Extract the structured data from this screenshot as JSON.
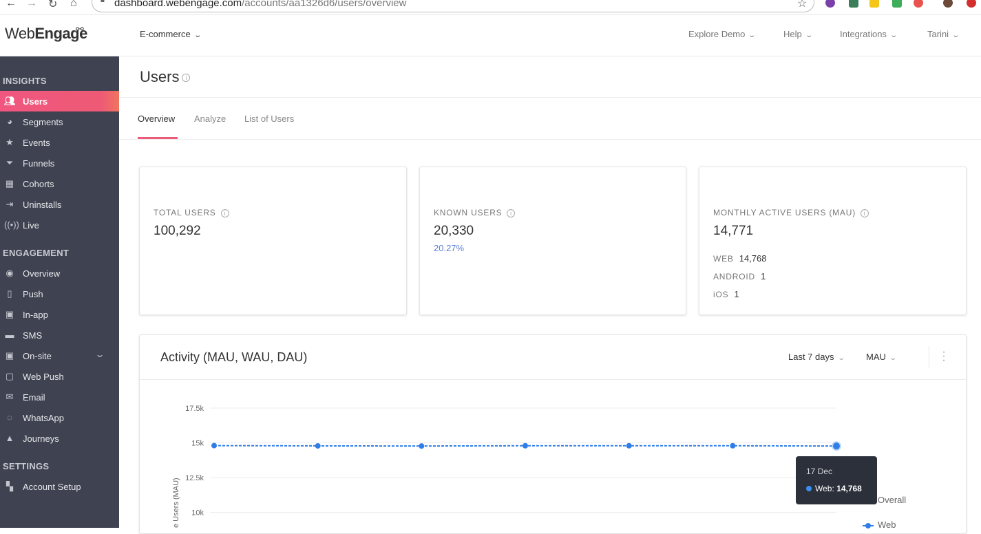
{
  "browser": {
    "url_host": "dashboard.webengage.com",
    "url_path": "/accounts/aa1326d6/users/overview"
  },
  "header": {
    "logo": {
      "part1": "Web",
      "part2": "Engage"
    },
    "project": "E-commerce",
    "menu": [
      "Explore Demo",
      "Help",
      "Integrations",
      "Tarini"
    ]
  },
  "sidebar": {
    "sections": [
      {
        "title": "INSIGHTS",
        "items": [
          "Users",
          "Segments",
          "Events",
          "Funnels",
          "Cohorts",
          "Uninstalls",
          "Live"
        ]
      },
      {
        "title": "ENGAGEMENT",
        "items": [
          "Overview",
          "Push",
          "In-app",
          "SMS",
          "On-site",
          "Web Push",
          "Email",
          "WhatsApp",
          "Journeys"
        ]
      },
      {
        "title": "SETTINGS",
        "items": [
          "Account Setup"
        ]
      }
    ],
    "active_item": "Users"
  },
  "page": {
    "title": "Users",
    "tabs": [
      "Overview",
      "Analyze",
      "List of Users"
    ],
    "active_tab": "Overview"
  },
  "cards": {
    "total": {
      "label": "TOTAL USERS",
      "value": "100,292"
    },
    "known": {
      "label": "KNOWN USERS",
      "value": "20,330",
      "percent": "20.27%"
    },
    "mau": {
      "label": "MONTHLY ACTIVE USERS (MAU)",
      "value": "14,771",
      "platforms": [
        {
          "name": "WEB",
          "value": "14,768"
        },
        {
          "name": "ANDROID",
          "value": "1"
        },
        {
          "name": "iOS",
          "value": "1"
        }
      ]
    }
  },
  "activity": {
    "title": "Activity (MAU, WAU, DAU)",
    "range": "Last 7 days",
    "metric": "MAU",
    "tooltip": {
      "date": "17 Dec",
      "series": "Web:",
      "value": "14,768"
    },
    "legend": {
      "overall": "Overall",
      "web": "Web"
    }
  },
  "chart_data": {
    "type": "line",
    "ylabel": "Users (MAU)",
    "ylabel_visible_text": "e Users (MAU)",
    "yticks": [
      "17.5k",
      "15k",
      "12.5k",
      "10k"
    ],
    "ylim": [
      10000,
      17500
    ],
    "grid": true,
    "series": [
      {
        "name": "Web",
        "values": [
          14800,
          14780,
          14770,
          14790,
          14790,
          14790,
          14768
        ]
      }
    ],
    "legend_placement": "right",
    "colors": {
      "web": "#2f7ee8"
    }
  }
}
